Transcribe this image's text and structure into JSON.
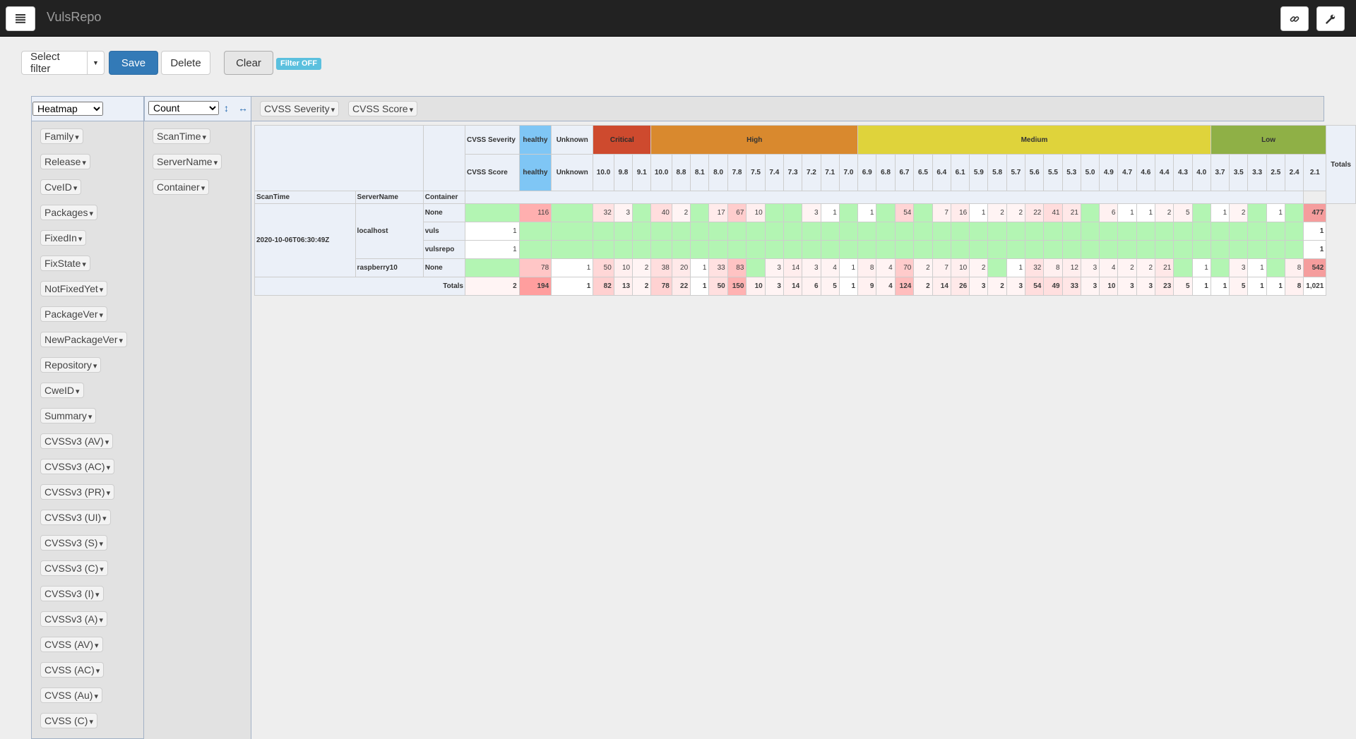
{
  "app": {
    "title": "VulsRepo"
  },
  "navbar": {
    "menu_icon": "hamburger-icon",
    "link_icon": "link-icon",
    "settings_icon": "wrench-icon"
  },
  "toolbar": {
    "select_filter": "Select filter",
    "save": "Save",
    "delete": "Delete",
    "clear": "Clear",
    "filter_status": "Filter OFF"
  },
  "renderer": {
    "selected": "Heatmap"
  },
  "aggregator": {
    "selected": "Count"
  },
  "colors": {
    "critical": "#ce4a2e",
    "high": "#d9892e",
    "medium": "#dfd33b",
    "low": "#8fb046",
    "healthy": "#7fc6f5",
    "green_cell": "#b3f5b3"
  },
  "col_attrs": [
    "CVSS Severity",
    "CVSS Score"
  ],
  "row_attrs": [
    "ScanTime",
    "ServerName",
    "Container"
  ],
  "unused_attrs": [
    "Family",
    "Release",
    "CveID",
    "Packages",
    "FixedIn",
    "FixState",
    "NotFixedYet",
    "PackageVer",
    "NewPackageVer",
    "Repository",
    "CweID",
    "Summary",
    "CVSSv3 (AV)",
    "CVSSv3 (AC)",
    "CVSSv3 (PR)",
    "CVSSv3 (UI)",
    "CVSSv3 (S)",
    "CVSSv3 (C)",
    "CVSSv3 (I)",
    "CVSSv3 (A)",
    "CVSS (AV)",
    "CVSS (AC)",
    "CVSS (Au)",
    "CVSS (C)"
  ],
  "table": {
    "col_axis_labels": [
      "CVSS Severity",
      "CVSS Score"
    ],
    "row_headers": [
      "ScanTime",
      "ServerName",
      "Container"
    ],
    "totals_label": "Totals",
    "severity_groups": [
      {
        "label": "healthy",
        "span": 1,
        "color": "#7fc6f5",
        "text_color": "#333"
      },
      {
        "label": "Unknown",
        "span": 1,
        "color": "#ebf0f8",
        "text_color": "#333"
      },
      {
        "label": "Critical",
        "span": 3,
        "color": "#ce4a2e",
        "text_color": "#2b2b2b"
      },
      {
        "label": "High",
        "span": 11,
        "color": "#d9892e",
        "text_color": "#333"
      },
      {
        "label": "Medium",
        "span": 19,
        "color": "#dfd33b",
        "text_color": "#333"
      },
      {
        "label": "Low",
        "span": 6,
        "color": "#8fb046",
        "text_color": "#333"
      }
    ],
    "scores": [
      "healthy",
      "Unknown",
      "10.0",
      "9.8",
      "9.1",
      "10.0",
      "8.8",
      "8.1",
      "8.0",
      "7.8",
      "7.5",
      "7.4",
      "7.3",
      "7.2",
      "7.1",
      "7.0",
      "6.9",
      "6.8",
      "6.7",
      "6.5",
      "6.4",
      "6.1",
      "5.9",
      "5.8",
      "5.7",
      "5.6",
      "5.5",
      "5.3",
      "5.0",
      "4.9",
      "4.7",
      "4.6",
      "4.4",
      "4.3",
      "4.0",
      "3.7",
      "3.5",
      "3.3",
      "2.5",
      "2.4",
      "2.1"
    ],
    "scan_time": "2020-10-06T06:30:49Z",
    "rows": [
      {
        "server": "localhost",
        "container": "None",
        "total": "477",
        "cells": [
          "",
          "116",
          "",
          "32",
          "3",
          "",
          "40",
          "2",
          "",
          "17",
          "67",
          "10",
          "",
          "",
          "3",
          "1",
          "",
          "1",
          "",
          "54",
          "",
          "7",
          "16",
          "1",
          "2",
          "2",
          "22",
          "41",
          "21",
          "",
          "6",
          "1",
          "1",
          "2",
          "5",
          "",
          "1",
          "2",
          "",
          "1",
          ""
        ]
      },
      {
        "server": "localhost",
        "container": "vuls",
        "total": "1",
        "cells": [
          "1",
          "",
          "",
          "",
          "",
          "",
          "",
          "",
          "",
          "",
          "",
          "",
          "",
          "",
          "",
          "",
          "",
          "",
          "",
          "",
          "",
          "",
          "",
          "",
          "",
          "",
          "",
          "",
          "",
          "",
          "",
          "",
          "",
          "",
          "",
          "",
          "",
          "",
          "",
          "",
          ""
        ]
      },
      {
        "server": "localhost",
        "container": "vulsrepo",
        "total": "1",
        "cells": [
          "1",
          "",
          "",
          "",
          "",
          "",
          "",
          "",
          "",
          "",
          "",
          "",
          "",
          "",
          "",
          "",
          "",
          "",
          "",
          "",
          "",
          "",
          "",
          "",
          "",
          "",
          "",
          "",
          "",
          "",
          "",
          "",
          "",
          "",
          "",
          "",
          "",
          "",
          "",
          "",
          ""
        ]
      },
      {
        "server": "raspberry10",
        "container": "None",
        "total": "542",
        "cells": [
          "",
          "78",
          "1",
          "50",
          "10",
          "2",
          "38",
          "20",
          "1",
          "33",
          "83",
          "",
          "3",
          "14",
          "3",
          "4",
          "1",
          "8",
          "4",
          "70",
          "2",
          "7",
          "10",
          "2",
          "",
          "1",
          "32",
          "8",
          "12",
          "3",
          "4",
          "2",
          "2",
          "21",
          "",
          "1",
          "",
          "3",
          "1",
          "",
          "8"
        ]
      }
    ],
    "column_totals": [
      "2",
      "194",
      "1",
      "82",
      "13",
      "2",
      "78",
      "22",
      "1",
      "50",
      "150",
      "10",
      "3",
      "14",
      "6",
      "5",
      "1",
      "9",
      "4",
      "124",
      "2",
      "14",
      "26",
      "3",
      "2",
      "3",
      "54",
      "49",
      "33",
      "3",
      "10",
      "3",
      "3",
      "23",
      "5",
      "1",
      "1",
      "5",
      "1",
      "1",
      "8"
    ],
    "grand_total": "1,021"
  }
}
